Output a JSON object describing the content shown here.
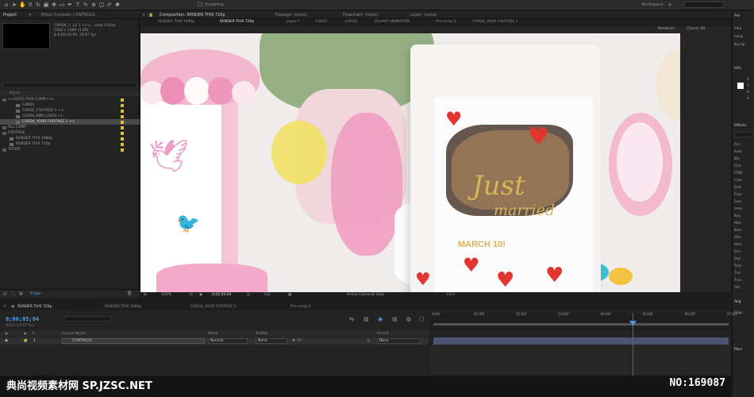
{
  "toolbar": {
    "snapping_label": "Snapping",
    "workspace_label": "Workspace:"
  },
  "project_panel": {
    "tab_label": "Project",
    "effect_controls_label": "Effect Controls: CONTROLS",
    "comp_info": {
      "name": "CARD4_Y...LE 1 >>+ , used 1 time",
      "size": "1920 x 1080 (1.00)",
      "duration": "Δ 0;00;10;00, 29.97 fps"
    },
    "header_name": "Name",
    "items": [
      {
        "label": "<<GOTO THIS COMP>>>",
        "indent": 0,
        "selected": false
      },
      {
        "label": "CARD1",
        "indent": 1,
        "selected": false
      },
      {
        "label": "CARD2_FOOTAGE 1 >>",
        "indent": 1,
        "selected": false
      },
      {
        "label": "CARD3_MINI_LOGO >>",
        "indent": 1,
        "selected": false
      },
      {
        "label": "CARD4_YOUR FOOTAGE 1 >>",
        "indent": 1,
        "selected": true
      },
      {
        "label": "ALL COMP",
        "indent": 0,
        "selected": false
      },
      {
        "label": "FOOTAGE",
        "indent": 0,
        "selected": false
      },
      {
        "label": "RENDER THIS 1080p",
        "indent": 1,
        "selected": false
      },
      {
        "label": "RENDER THIS 720p",
        "indent": 1,
        "selected": false
      },
      {
        "label": "TUTOR",
        "indent": 0,
        "selected": false
      }
    ],
    "bottom_bpc": "8 bpc"
  },
  "comp_panel": {
    "panel_tab": "Composition: RENDER THIS 720p",
    "footage_tab": "Footage: (none)",
    "flowchart_tab": "Flowchart: (none)",
    "layer_tab": "Layer: (none)",
    "tabs": [
      "RENDER THIS 1080p",
      "RENDER THIS 720p",
      "paper7",
      "CARD1",
      "CARD3",
      "ZUHAIR ANIMATION",
      "Pre-comp 2",
      "CARD4_YOUR FOOTAGE 1"
    ],
    "renderer_label": "Renderer:",
    "renderer_value": "Classic 3D",
    "footer": {
      "zoom": "100%",
      "timecode": "0;00;05;04",
      "resolution": "Full",
      "camera": "Active Camera",
      "views": "1 View",
      "exposure": "+0.0"
    },
    "card": {
      "line1": "Just",
      "line2": "married",
      "date": "MARCH 10!"
    }
  },
  "right_panel": {
    "items": [
      "Pre",
      "Pala",
      "Leng",
      "Nump",
      "Info",
      "R",
      "G",
      "B",
      "A",
      "Effects",
      "Ani",
      "Aud",
      "Blu",
      "Cha",
      "CINE",
      "Colo",
      "Dist",
      "Expr",
      "Gen",
      "Imm",
      "Key",
      "Mat",
      "Nois",
      "Obs",
      "Pers",
      "Sim",
      "Styl",
      "Text",
      "Tim",
      "Tran",
      "Util",
      "Alig",
      "Align",
      "Para"
    ]
  },
  "timeline": {
    "tabs": [
      "RENDER THIS 720p",
      "RENDER THIS 1080p",
      "CARD4_YOUR FOOTAGE 1",
      "Pre-comp 2"
    ],
    "timecode": "0;00;05;04",
    "timecode_sub": "00154 (29.97 fps)",
    "columns": {
      "source_name": "Source Name",
      "mode": "Mode",
      "trkmat": "TrkMat",
      "parent": "Parent"
    },
    "layer": {
      "index": "1",
      "name": "CONTROLS",
      "mode": "Normal",
      "trkmat": "None",
      "parent": "None"
    },
    "ruler_ticks": [
      "0;00f",
      "01;00f",
      "02;00f",
      "03;00f",
      "04;00f",
      "05;00f",
      "06;00f",
      "07;00f"
    ],
    "playhead_fraction": 0.68
  },
  "watermark": {
    "left": "典尚视频素材网 SP.JZSC.NET",
    "right": "NO:169087"
  },
  "colors": {
    "accent_blue": "#4e9de8",
    "label_yellow": "#d9c33a",
    "playhead_red": "#c23c3c",
    "track_purple": "#4d5373"
  }
}
